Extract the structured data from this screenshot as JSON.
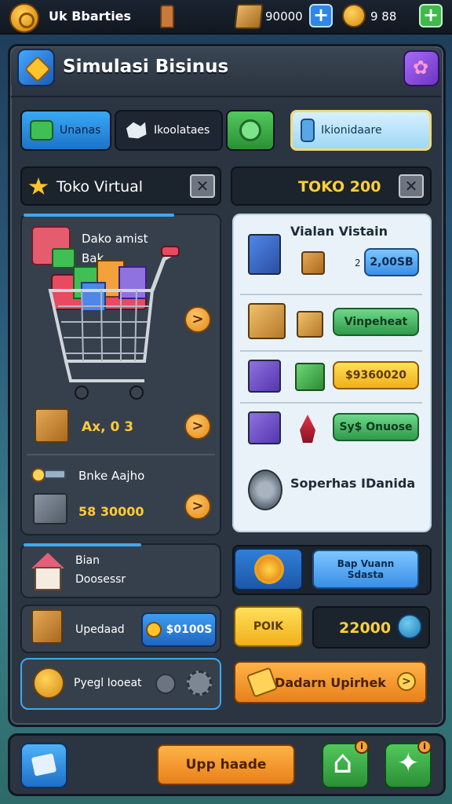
{
  "topbar": {
    "title": "Uk Bbarties",
    "resource1_value": "90000",
    "resource2_value": "9 88",
    "plus_label": "+"
  },
  "panel": {
    "title": "Simulasi Bisinus"
  },
  "tabs": [
    {
      "label": "Unanas"
    },
    {
      "label": "Ikoolataes"
    },
    {
      "label": ""
    },
    {
      "label": "Ikionidaare"
    }
  ],
  "left": {
    "header_title": "Toko Virtual",
    "close_label": "✕",
    "product_line1": "Dako amist",
    "product_line2": "Bak",
    "stat_value": "Ax, 0 3",
    "bank_title": "Bnke Aajho",
    "bank_value": "58 30000",
    "arrow_label": ">",
    "house_line1": "Bian",
    "house_line2": "Doosessr",
    "upgrade_label": "Upedaad",
    "upgrade_cost": "$0100S",
    "pyegl_label": "Pyegl Iooeat"
  },
  "right": {
    "header_title": "TOKO 200",
    "close_label": "✕",
    "card_title": "Vialan Vistain",
    "row1_num": "2",
    "row1_btn": "2,00SB",
    "row2_btn": "Vinpeheat",
    "row3_btn": "$9360020",
    "row4_btn": "Sy$ Onuose",
    "footer_title": "Soperhas IDanida",
    "blue_btn_line1": "Bap Vuann",
    "blue_btn_line2": "Sdasta",
    "yellow_btn": "POIK",
    "value_box": "22000",
    "orange_btn": "Dadarn Upirhek",
    "orange_go": ">"
  },
  "bottombar": {
    "upgrade_label": "Upp haade",
    "notif1": "i",
    "notif2": "i"
  }
}
